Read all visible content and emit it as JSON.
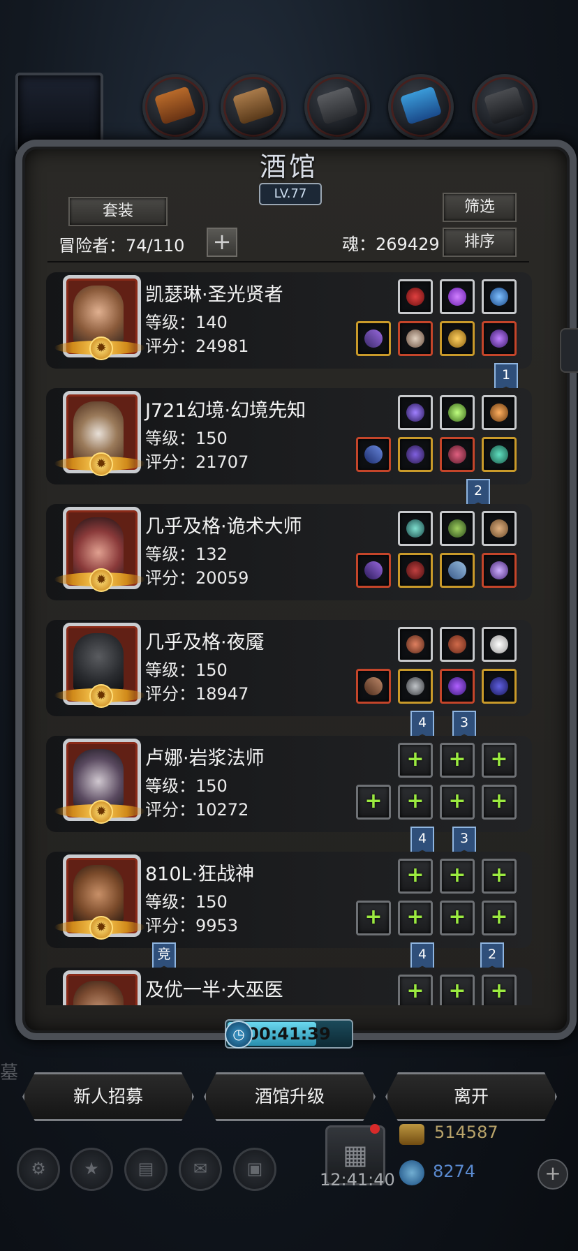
{
  "title": "酒馆",
  "level_badge": "LV.77",
  "buttons": {
    "set": "套装",
    "filter": "筛选",
    "sort": "排序",
    "recruit": "新人招募",
    "upgrade": "酒馆升级",
    "leave": "离开"
  },
  "adventurers_label": "冒险者：74/110",
  "soul_label": "魂：269429",
  "timer": "00:41:39",
  "timer_progress": 0.72,
  "heroes": [
    {
      "name": "凯瑟琳·圣光贤者",
      "level": "等级：140",
      "score": "评分：24981",
      "face_color": "#c9926a"
    },
    {
      "name": "J721幻境·幻境先知",
      "level": "等级：150",
      "score": "评分：21707",
      "face_color": "#a88a6a"
    },
    {
      "name": "几乎及格·诡术大师",
      "level": "等级：132",
      "score": "评分：20059",
      "face_color": "#d09080"
    },
    {
      "name": "几乎及格·夜魇",
      "level": "等级：150",
      "score": "评分：18947",
      "face_color": "#2a2c30"
    },
    {
      "name": "卢娜·岩浆法师",
      "level": "等级：150",
      "score": "评分：10272",
      "face_color": "#b8b4b8"
    },
    {
      "name": "810L·狂战神",
      "level": "等级：150",
      "score": "评分：9953",
      "face_color": "#a06a40"
    },
    {
      "name": "及优一半·大巫医",
      "level": "",
      "score": "",
      "face_color": "#9a6a4a"
    }
  ],
  "rank_flags": [
    "1",
    "2",
    "4",
    "3",
    "4",
    "3",
    "竞",
    "4",
    "2"
  ],
  "hud": {
    "time": "12:41:40",
    "gold": "514587",
    "diamonds": "8274",
    "side_text": "墓"
  },
  "icons": {
    "add": "plus-icon",
    "clock": "clock-icon",
    "gift": "gift-box-icon",
    "gold": "gold-coin-icon",
    "diamond": "diamond-icon"
  },
  "colors": {
    "empty_slot_plus": "#9bea40",
    "flag_blue": "#2f4f7a",
    "timer_cyan": "#6ad8ee"
  }
}
